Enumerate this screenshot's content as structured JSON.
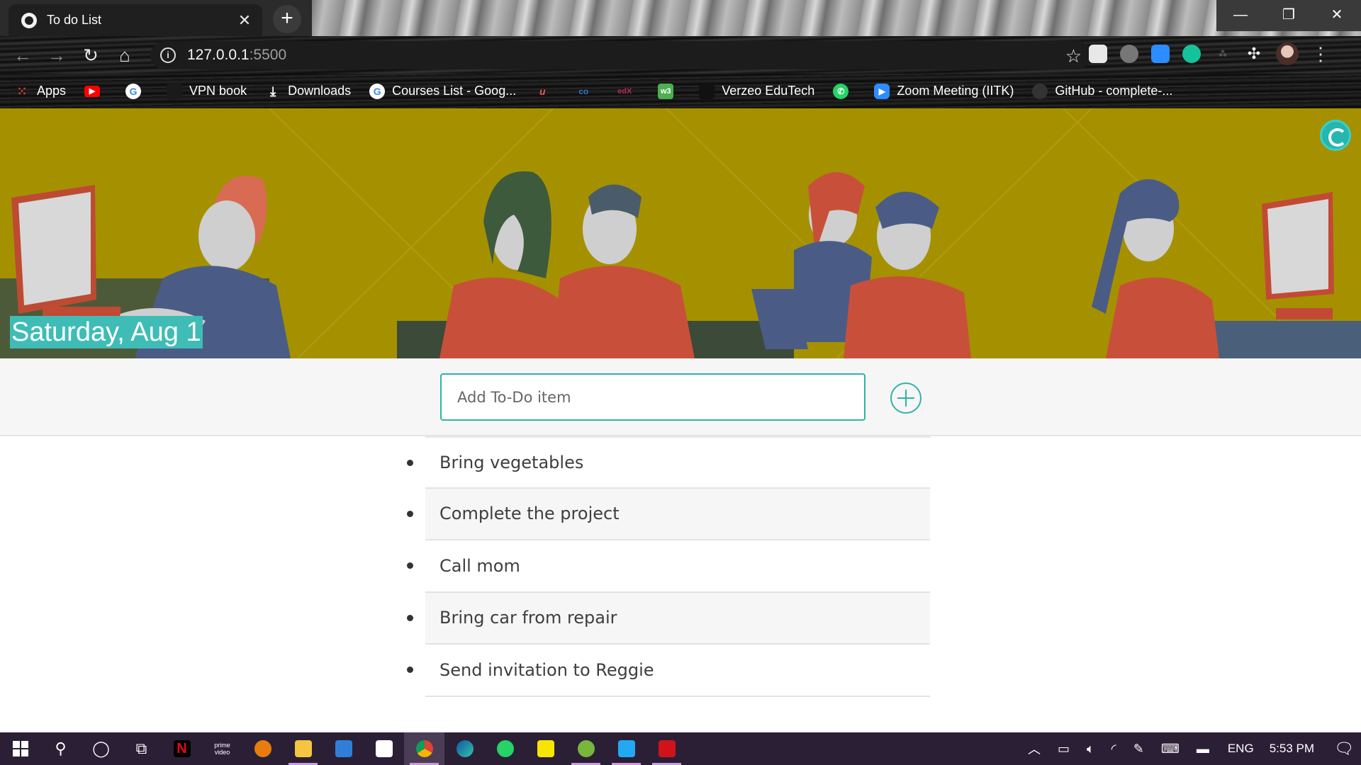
{
  "browser": {
    "tab_title": "To do List",
    "tab_close": "✕",
    "new_tab": "+",
    "window_minimize": "—",
    "window_restore": "❐",
    "window_close": "✕",
    "url_host": "127.0.0.1",
    "url_port": ":5500",
    "bookmarks": [
      {
        "label": "Apps",
        "icon": "apps-grid-icon",
        "color": "#e33b2e"
      },
      {
        "label": "",
        "icon": "youtube-icon",
        "color": "#ff0000"
      },
      {
        "label": "",
        "icon": "google-icon",
        "color": "#4285f4"
      },
      {
        "label": "VPN book",
        "icon": "vpnbook-icon",
        "color": "#222222"
      },
      {
        "label": "Downloads",
        "icon": "download-icon",
        "color": "#ffffff"
      },
      {
        "label": "Courses List - Goog...",
        "icon": "google-icon",
        "color": "#4285f4"
      },
      {
        "label": "",
        "icon": "udemy-icon",
        "color": "#ec5252"
      },
      {
        "label": "",
        "icon": "coursera-icon",
        "color": "#2a73cc"
      },
      {
        "label": "",
        "icon": "edx-icon",
        "color": "#b12a5b"
      },
      {
        "label": "",
        "icon": "w3schools-icon",
        "color": "#4caf50"
      },
      {
        "label": "Verzeo EduTech",
        "icon": "verzeo-icon",
        "color": "#111111"
      },
      {
        "label": "",
        "icon": "whatsapp-icon",
        "color": "#25d366"
      },
      {
        "label": "Zoom Meeting (IITK)",
        "icon": "zoom-icon",
        "color": "#2d8cff"
      },
      {
        "label": "GitHub - complete-...",
        "icon": "github-icon",
        "color": "#333333"
      }
    ]
  },
  "page": {
    "date": "Saturday, Aug 1",
    "input_placeholder": "Add To-Do item",
    "accent": "#2fb3a8",
    "todos": [
      "Bring vegetables",
      "Complete the project",
      "Call mom",
      "Bring car from repair",
      "Send invitation to Reggie"
    ]
  },
  "taskbar": {
    "apps": [
      "start-icon",
      "search-icon",
      "cortana-icon",
      "task-view-icon",
      "netflix-icon",
      "prime-video-icon",
      "blender-icon",
      "file-explorer-icon",
      "mail-icon",
      "store-icon",
      "chrome-icon",
      "edge-icon",
      "whatsapp-icon",
      "sticky-notes-icon",
      "utorrent-icon",
      "vscode-icon",
      "acrobat-icon"
    ],
    "language": "ENG",
    "time": "5:53 PM"
  }
}
